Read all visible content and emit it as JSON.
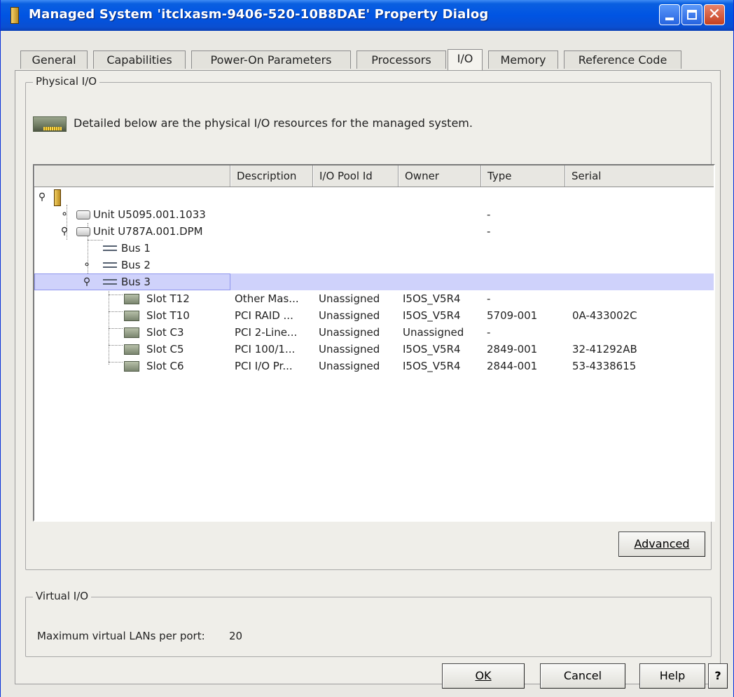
{
  "window": {
    "title": "Managed System 'itclxasm-9406-520-10B8DAE' Property Dialog"
  },
  "tabs": [
    "General",
    "Capabilities",
    "Power-On Parameters",
    "Processors",
    "I/O",
    "Memory",
    "Reference Code"
  ],
  "physical_io": {
    "group_title": "Physical I/O",
    "description": "Detailed below are the physical I/O resources for the managed system.",
    "columns": [
      "Description",
      "I/O Pool Id",
      "Owner",
      "Type",
      "Serial"
    ],
    "rows": [
      {
        "name": "Unit U5095.001.1033",
        "description": "",
        "pool": "",
        "owner": "",
        "type": "-",
        "serial": ""
      },
      {
        "name": "Unit U787A.001.DPM",
        "description": "",
        "pool": "",
        "owner": "",
        "type": "-",
        "serial": ""
      },
      {
        "name": "Bus 1",
        "description": "",
        "pool": "",
        "owner": "",
        "type": "",
        "serial": ""
      },
      {
        "name": "Bus 2",
        "description": "",
        "pool": "",
        "owner": "",
        "type": "",
        "serial": ""
      },
      {
        "name": "Bus 3",
        "description": "",
        "pool": "",
        "owner": "",
        "type": "",
        "serial": ""
      },
      {
        "name": "Slot T12",
        "description": "Other Mas...",
        "pool": "Unassigned",
        "owner": "I5OS_V5R4",
        "type": "-",
        "serial": ""
      },
      {
        "name": "Slot T10",
        "description": "PCI RAID ...",
        "pool": "Unassigned",
        "owner": "I5OS_V5R4",
        "type": "5709-001",
        "serial": "0A-433002C"
      },
      {
        "name": "Slot C3",
        "description": "PCI 2-Line...",
        "pool": "Unassigned",
        "owner": "Unassigned",
        "type": "-",
        "serial": ""
      },
      {
        "name": "Slot C5",
        "description": "PCI 100/1...",
        "pool": "Unassigned",
        "owner": "I5OS_V5R4",
        "type": "2849-001",
        "serial": "32-41292AB"
      },
      {
        "name": "Slot C6",
        "description": "PCI I/O Pr...",
        "pool": "Unassigned",
        "owner": "I5OS_V5R4",
        "type": "2844-001",
        "serial": "53-4338615"
      }
    ],
    "advanced_button": "Advanced"
  },
  "virtual_io": {
    "group_title": "Virtual I/O",
    "max_vlans_label": "Maximum virtual LANs per port:",
    "max_vlans_value": "20"
  },
  "buttons": {
    "ok": "OK",
    "cancel": "Cancel",
    "help": "Help",
    "context_help": "?"
  },
  "icons": [
    "frame-icon",
    "unit-icon",
    "bus-icon",
    "slot-icon",
    "minimize-icon",
    "maximize-icon",
    "close-icon",
    "expand-handle-icon",
    "collapse-handle-icon"
  ],
  "colors": {
    "titlebar": "#0054e3",
    "selection": "#cfd2fb",
    "dialog_bg": "#efeee9"
  }
}
